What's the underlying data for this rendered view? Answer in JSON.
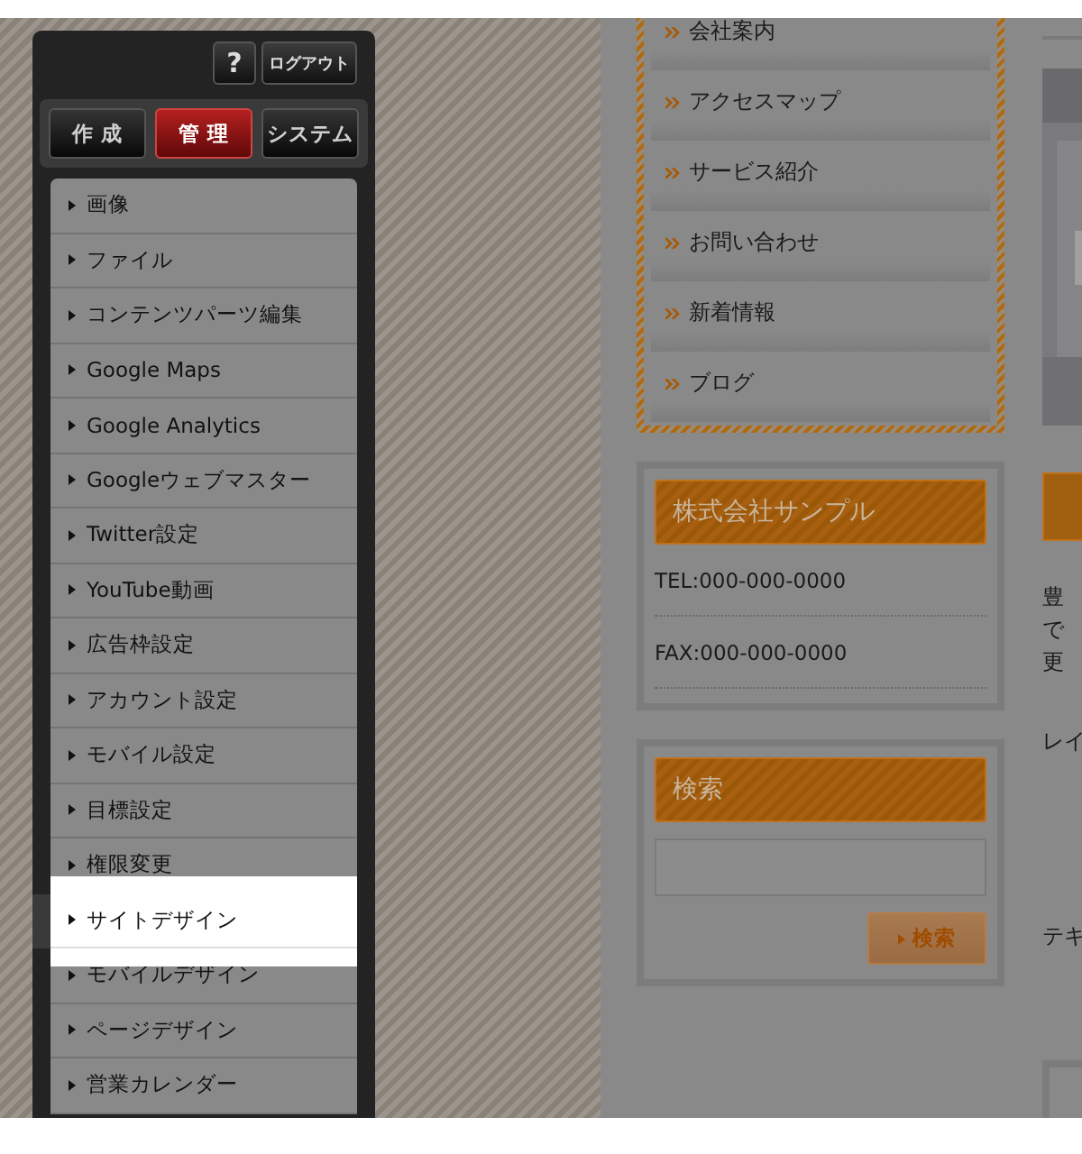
{
  "header_buttons": [
    {
      "kind": "help",
      "label": "?"
    },
    {
      "kind": "logout",
      "label": "ログアウト"
    }
  ],
  "tabs": [
    {
      "label": "作 成",
      "selected": false
    },
    {
      "label": "管 理",
      "selected": true
    },
    {
      "label": "システム",
      "selected": false
    }
  ],
  "menu": [
    {
      "label": "画像",
      "highlighted": false
    },
    {
      "label": "ファイル",
      "highlighted": false
    },
    {
      "label": "コンテンツパーツ編集",
      "highlighted": false
    },
    {
      "label": "Google Maps",
      "highlighted": false
    },
    {
      "label": "Google Analytics",
      "highlighted": false
    },
    {
      "label": "Googleウェブマスター",
      "highlighted": false
    },
    {
      "label": "Twitter設定",
      "highlighted": false
    },
    {
      "label": "YouTube動画",
      "highlighted": false
    },
    {
      "label": "広告枠設定",
      "highlighted": false
    },
    {
      "label": "アカウント設定",
      "highlighted": false
    },
    {
      "label": "モバイル設定",
      "highlighted": false
    },
    {
      "label": "目標設定",
      "highlighted": false
    },
    {
      "label": "権限変更",
      "highlighted": false
    },
    {
      "label": "サイトデザイン",
      "highlighted": true
    },
    {
      "label": "モバイルデザイン",
      "highlighted": false
    },
    {
      "label": "ページデザイン",
      "highlighted": false
    },
    {
      "label": "営業カレンダー",
      "highlighted": false
    }
  ],
  "site_nav": [
    "会社案内",
    "アクセスマップ",
    "サービス紹介",
    "お問い合わせ",
    "新着情報",
    "ブログ"
  ],
  "company": {
    "title": "株式会社サンプル",
    "lines": [
      "TEL:000-000-0000",
      "FAX:000-000-0000"
    ]
  },
  "search": {
    "title": "検索",
    "button": "検索"
  },
  "right_texts": [
    "豊",
    "で",
    "更",
    "レイ",
    "テキ"
  ]
}
